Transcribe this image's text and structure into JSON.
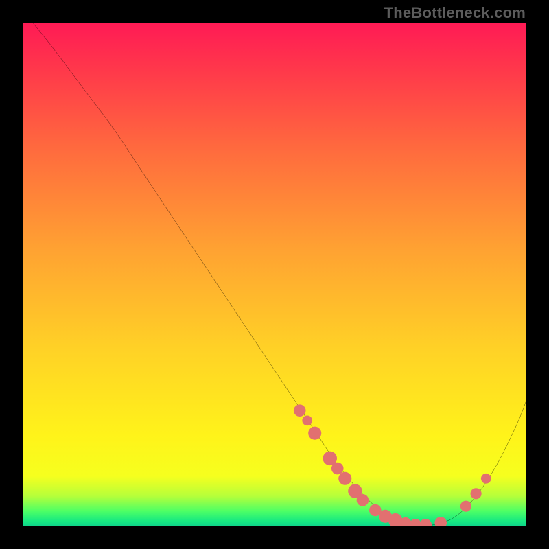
{
  "attribution": "TheBottleneck.com",
  "chart_data": {
    "type": "line",
    "title": "",
    "xlabel": "",
    "ylabel": "",
    "xlim": [
      0,
      100
    ],
    "ylim": [
      0,
      100
    ],
    "series": [
      {
        "name": "bottleneck-curve",
        "x": [
          2,
          6,
          12,
          18,
          24,
          30,
          36,
          42,
          48,
          54,
          58,
          62,
          66,
          70,
          74,
          78,
          82,
          86,
          90,
          94,
          98,
          100
        ],
        "y": [
          100,
          95,
          87,
          79,
          70,
          61,
          52,
          43,
          34,
          25,
          19,
          13,
          8,
          4,
          1.2,
          0.2,
          0.4,
          2,
          6,
          12,
          20,
          25
        ]
      }
    ],
    "markers": [
      {
        "name": "marker-left-1",
        "x": 55,
        "y": 23,
        "r": 1.2
      },
      {
        "name": "marker-left-2",
        "x": 56.5,
        "y": 21,
        "r": 1.0
      },
      {
        "name": "marker-left-3",
        "x": 58,
        "y": 18.5,
        "r": 1.3
      },
      {
        "name": "marker-left-4",
        "x": 61,
        "y": 13.5,
        "r": 1.4
      },
      {
        "name": "marker-left-5",
        "x": 62.5,
        "y": 11.5,
        "r": 1.2
      },
      {
        "name": "marker-left-6",
        "x": 64,
        "y": 9.5,
        "r": 1.3
      },
      {
        "name": "marker-left-7",
        "x": 66,
        "y": 7,
        "r": 1.4
      },
      {
        "name": "marker-left-8",
        "x": 67.5,
        "y": 5.2,
        "r": 1.2
      },
      {
        "name": "marker-bottom-1",
        "x": 70,
        "y": 3.2,
        "r": 1.2
      },
      {
        "name": "marker-bottom-2",
        "x": 72,
        "y": 2,
        "r": 1.3
      },
      {
        "name": "marker-bottom-3",
        "x": 74,
        "y": 1.2,
        "r": 1.4
      },
      {
        "name": "marker-bottom-4",
        "x": 76,
        "y": 0.6,
        "r": 1.2
      },
      {
        "name": "marker-bottom-5",
        "x": 78,
        "y": 0.3,
        "r": 1.2
      },
      {
        "name": "marker-bottom-6",
        "x": 80,
        "y": 0.3,
        "r": 1.2
      },
      {
        "name": "marker-bottom-7",
        "x": 83,
        "y": 0.7,
        "r": 1.2
      },
      {
        "name": "marker-right-1",
        "x": 88,
        "y": 4,
        "r": 1.1
      },
      {
        "name": "marker-right-2",
        "x": 90,
        "y": 6.5,
        "r": 1.1
      },
      {
        "name": "marker-right-3",
        "x": 92,
        "y": 9.5,
        "r": 1.0
      }
    ],
    "colors": {
      "curve": "#000000",
      "marker_fill": "#e27070",
      "marker_stroke": "#e27070"
    }
  }
}
